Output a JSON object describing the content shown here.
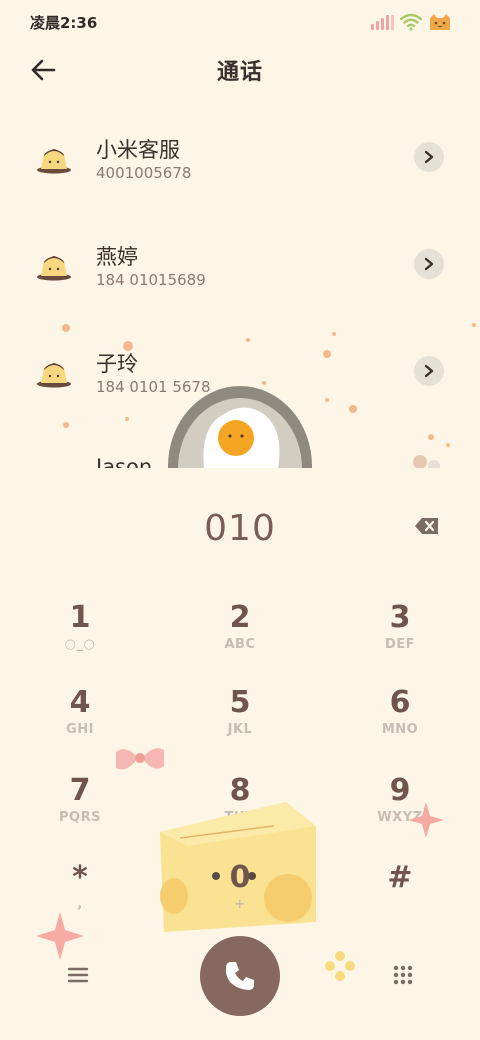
{
  "status_bar": {
    "time": "凌晨2:36",
    "icons": [
      "signal-icon",
      "wifi-icon",
      "battery-cat-icon"
    ]
  },
  "header": {
    "title": "通话",
    "back_icon": "arrow-left-icon"
  },
  "call_log": [
    {
      "name": "小米客服",
      "number": "4001005678"
    },
    {
      "name": "燕婷",
      "number": "184 01015689"
    },
    {
      "name": "子玲",
      "number": "184 0101 5678"
    },
    {
      "name": "Jason",
      "number": ""
    }
  ],
  "dialer": {
    "input": "010",
    "backspace_icon": "backspace-icon"
  },
  "keypad": [
    {
      "digit": "1",
      "letters": "○_○"
    },
    {
      "digit": "2",
      "letters": "ABC"
    },
    {
      "digit": "3",
      "letters": "DEF"
    },
    {
      "digit": "4",
      "letters": "GHI"
    },
    {
      "digit": "5",
      "letters": "JKL"
    },
    {
      "digit": "6",
      "letters": "MNO"
    },
    {
      "digit": "7",
      "letters": "PQRS"
    },
    {
      "digit": "8",
      "letters": "TUV"
    },
    {
      "digit": "9",
      "letters": "WXYZ"
    },
    {
      "digit": "*",
      "letters": ","
    },
    {
      "digit": "0",
      "letters": "+"
    },
    {
      "digit": "#",
      "letters": ""
    }
  ],
  "bottom": {
    "menu_icon": "menu-icon",
    "call_icon": "phone-icon",
    "dialpad_icon": "dialpad-icon"
  },
  "colors": {
    "background": "#fdf6e6",
    "call_button": "#86685f",
    "digit": "#6f554d"
  }
}
